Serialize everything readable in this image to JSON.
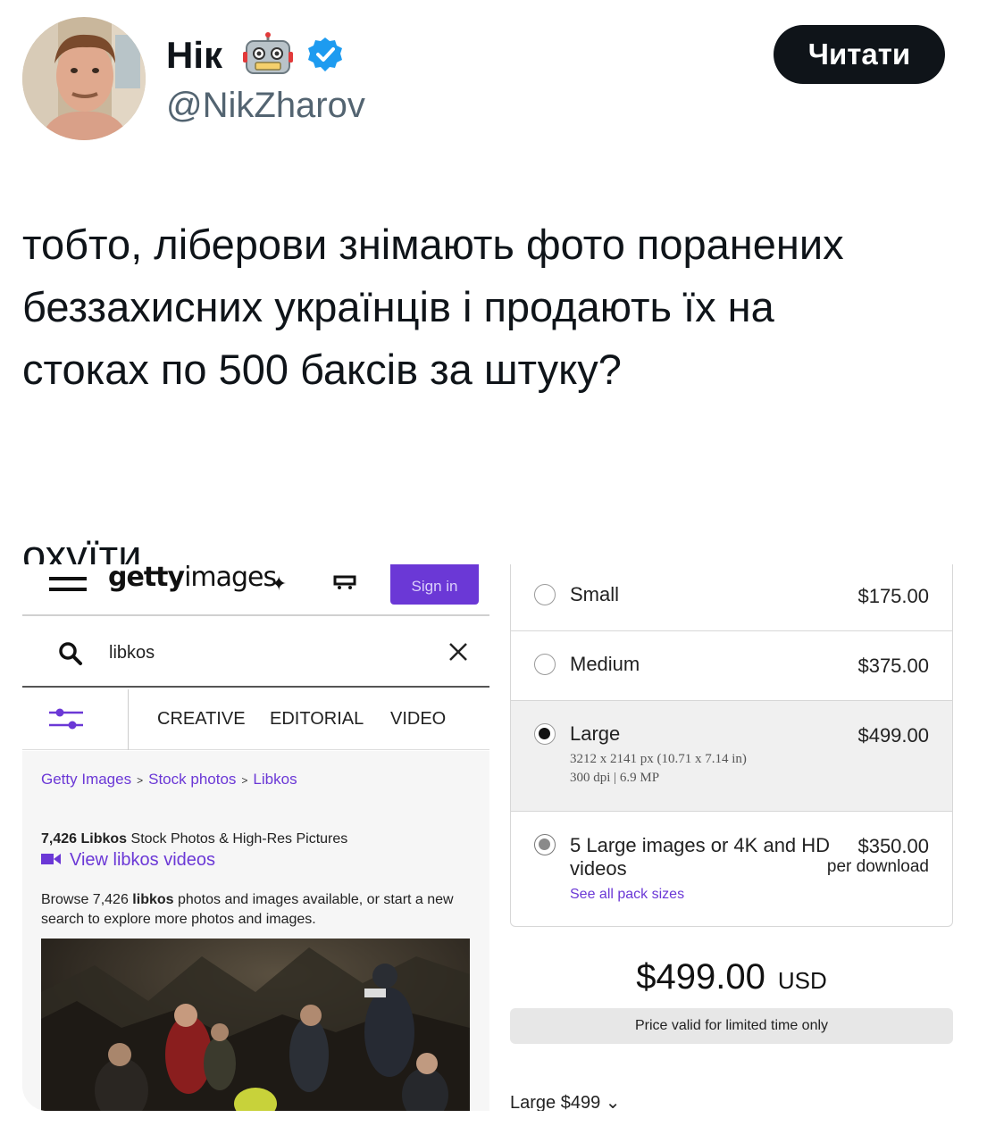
{
  "tweet": {
    "display_name": "Нік",
    "handle": "@NikZharov",
    "follow_label": "Читати",
    "text_lines": [
      "тобто, ліберови знімають фото поранених",
      "беззахисних українців і продають їх на",
      "стоках по 500 баксів за штуку?"
    ],
    "text_last": "охуїти.",
    "icons": {
      "name_emoji": "robot-face-icon",
      "verified": "verified-badge-icon"
    },
    "colors": {
      "verified": "#1d9bf0",
      "follow_bg": "#0f1419"
    }
  },
  "getty": {
    "logo_bold": "getty",
    "logo_light": "images",
    "signin_label": "Sign in",
    "search_value": "libkos",
    "tabs": [
      "CREATIVE",
      "EDITORIAL",
      "VIDEO"
    ],
    "breadcrumbs": [
      "Getty Images",
      "Stock photos",
      "Libkos"
    ],
    "result_count": "7,426",
    "result_term": "Libkos",
    "result_suffix": "Stock Photos & High-Res Pictures",
    "videos_link": "View libkos videos",
    "browse_prefix": "Browse 7,426",
    "browse_term": "libkos",
    "browse_suffix": "photos and images available, or start a new search to explore more photos and images.",
    "accent_color": "#6b38d6"
  },
  "pricing": {
    "options": [
      {
        "name": "Small",
        "price": "$175.00"
      },
      {
        "name": "Medium",
        "price": "$375.00"
      },
      {
        "name": "Large",
        "price": "$499.00",
        "detail_1": "3212 x 2141 px (10.71 x 7.14 in)",
        "detail_2": "300 dpi | 6.9 MP",
        "selected": true
      },
      {
        "name_1": "5 Large images or 4K and HD",
        "name_2": "videos",
        "price": "$350.00",
        "sub": "per download",
        "link": "See all pack sizes"
      }
    ],
    "total": "$499.00",
    "currency": "USD",
    "validity": "Price valid for limited time only",
    "size_select": "Large $499"
  }
}
